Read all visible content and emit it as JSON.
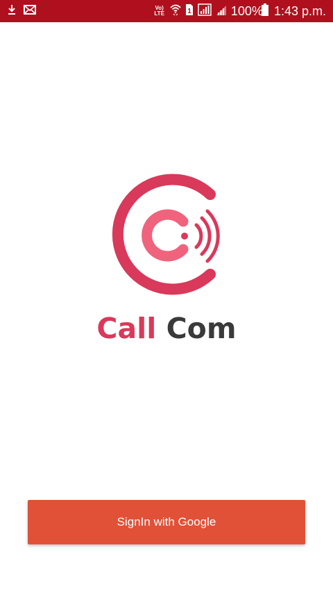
{
  "status_bar": {
    "volte_line1": "Vo)",
    "volte_line2": "LTE",
    "sim_slot": "1",
    "battery_percent": "100%",
    "time": "1:43 p.m."
  },
  "app": {
    "name_part1": "Call",
    "name_part2": "Com"
  },
  "signin_button": {
    "label": "SignIn with Google"
  },
  "colors": {
    "status_bar": "#b0101e",
    "brand_pink": "#d9395a",
    "brand_dark": "#3a3a3a",
    "button": "#e15137"
  }
}
